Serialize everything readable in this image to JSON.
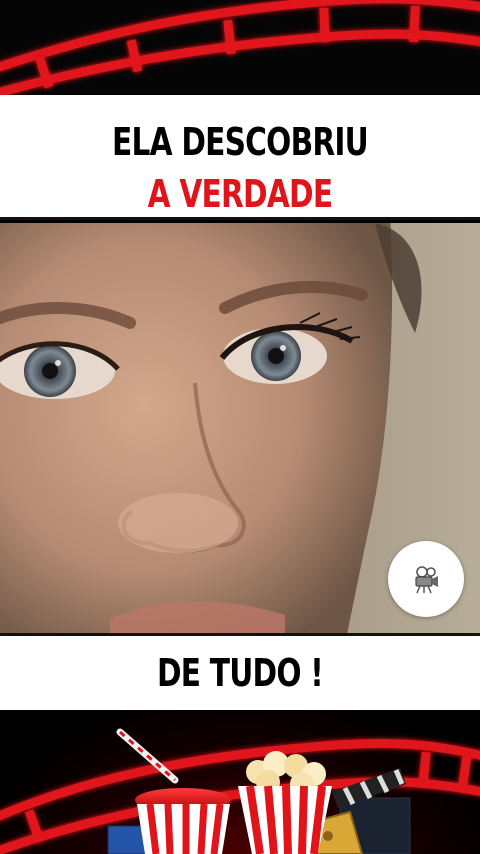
{
  "headline": {
    "line1": "ELA DESCOBRIU",
    "line2": "A VERDADE"
  },
  "caption": "DE TUDO !",
  "colors": {
    "headline_primary": "#000000",
    "headline_accent": "#e0141b",
    "film_strip": "#e0141b",
    "background": "#000000"
  },
  "icons": {
    "floating_button": "movie-camera-icon",
    "decor": [
      "film-strip",
      "soda-cup",
      "popcorn-bucket",
      "clapperboard",
      "ticket"
    ]
  }
}
